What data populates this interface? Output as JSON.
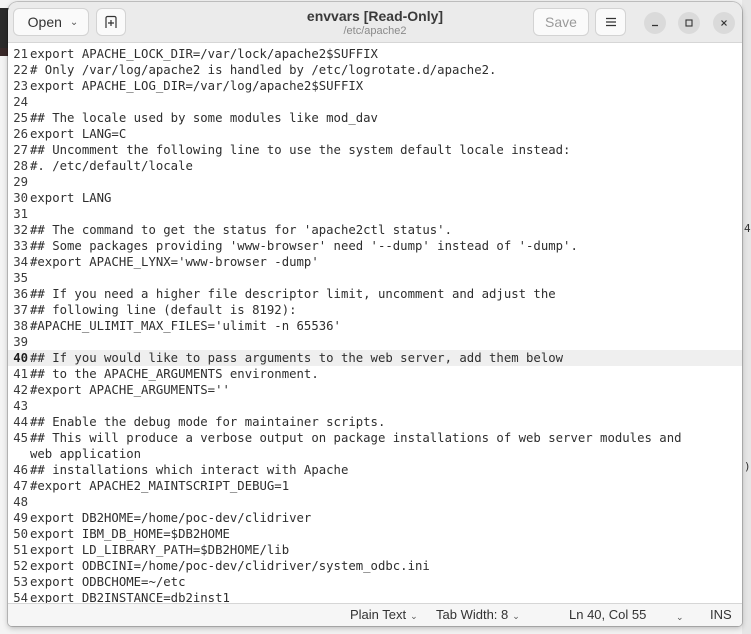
{
  "window": {
    "title": "envvars [Read-Only]",
    "subtitle": "/etc/apache2"
  },
  "header": {
    "open_label": "Open",
    "save_label": "Save",
    "icons": {
      "open_chevron": "chevron-down-icon",
      "new_tab": "new-tab-icon",
      "menu": "hamburger-menu-icon",
      "minimize": "minimize-icon",
      "maximize": "maximize-icon",
      "close": "close-icon"
    }
  },
  "editor": {
    "current_line": 40,
    "lines": [
      {
        "n": "21",
        "text": "export APACHE_LOCK_DIR=/var/lock/apache2$SUFFIX"
      },
      {
        "n": "22",
        "text": "# Only /var/log/apache2 is handled by /etc/logrotate.d/apache2."
      },
      {
        "n": "23",
        "text": "export APACHE_LOG_DIR=/var/log/apache2$SUFFIX"
      },
      {
        "n": "24",
        "text": ""
      },
      {
        "n": "25",
        "text": "## The locale used by some modules like mod_dav"
      },
      {
        "n": "26",
        "text": "export LANG=C"
      },
      {
        "n": "27",
        "text": "## Uncomment the following line to use the system default locale instead:"
      },
      {
        "n": "28",
        "text": "#. /etc/default/locale"
      },
      {
        "n": "29",
        "text": ""
      },
      {
        "n": "30",
        "text": "export LANG"
      },
      {
        "n": "31",
        "text": ""
      },
      {
        "n": "32",
        "text": "## The command to get the status for 'apache2ctl status'."
      },
      {
        "n": "33",
        "text": "## Some packages providing 'www-browser' need '--dump' instead of '-dump'."
      },
      {
        "n": "34",
        "text": "#export APACHE_LYNX='www-browser -dump'"
      },
      {
        "n": "35",
        "text": ""
      },
      {
        "n": "36",
        "text": "## If you need a higher file descriptor limit, uncomment and adjust the"
      },
      {
        "n": "37",
        "text": "## following line (default is 8192):"
      },
      {
        "n": "38",
        "text": "#APACHE_ULIMIT_MAX_FILES='ulimit -n 65536'"
      },
      {
        "n": "39",
        "text": ""
      },
      {
        "n": "40",
        "text": "## If you would like to pass arguments to the web server, add them below"
      },
      {
        "n": "41",
        "text": "## to the APACHE_ARGUMENTS environment."
      },
      {
        "n": "42",
        "text": "#export APACHE_ARGUMENTS=''"
      },
      {
        "n": "43",
        "text": ""
      },
      {
        "n": "44",
        "text": "## Enable the debug mode for maintainer scripts."
      },
      {
        "n": "45",
        "text": "## This will produce a verbose output on package installations of web server modules and",
        "wrap": "web application"
      },
      {
        "n": "46",
        "text": "## installations which interact with Apache"
      },
      {
        "n": "47",
        "text": "#export APACHE2_MAINTSCRIPT_DEBUG=1"
      },
      {
        "n": "48",
        "text": ""
      },
      {
        "n": "49",
        "text": "export DB2HOME=/home/poc-dev/clidriver"
      },
      {
        "n": "50",
        "text": "export IBM_DB_HOME=$DB2HOME"
      },
      {
        "n": "51",
        "text": "export LD_LIBRARY_PATH=$DB2HOME/lib"
      },
      {
        "n": "52",
        "text": "export ODBCINI=/home/poc-dev/clidriver/system_odbc.ini"
      },
      {
        "n": "53",
        "text": "export ODBCHOME=~/etc"
      },
      {
        "n": "54",
        "text": "export DB2INSTANCE=db2inst1"
      }
    ]
  },
  "statusbar": {
    "language": "Plain Text",
    "tab_width": "Tab Width: 8",
    "position": "Ln 40, Col 55",
    "mode": "INS"
  },
  "background": {
    "stray_right_1": "4",
    "stray_right_2": ")"
  }
}
